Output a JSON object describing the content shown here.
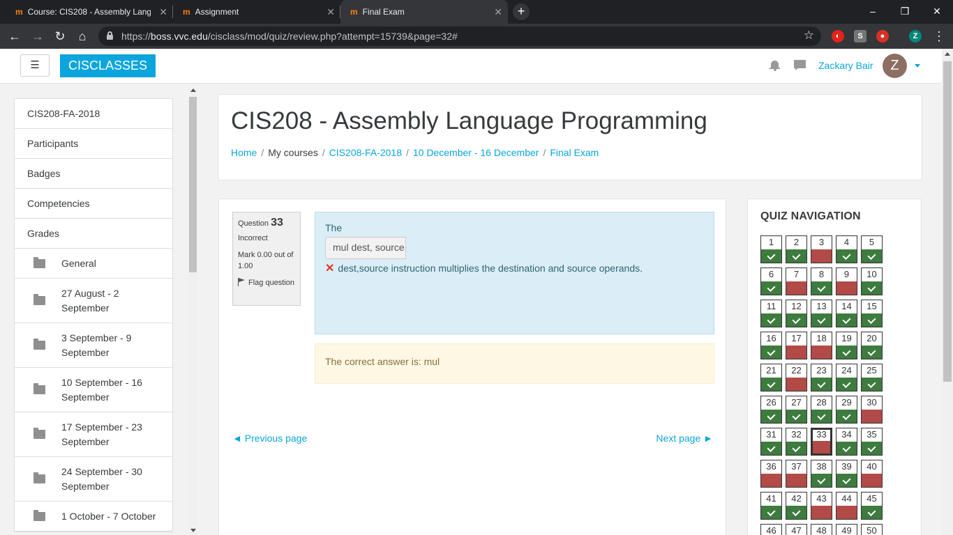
{
  "browser": {
    "tabs": [
      {
        "title": "Course: CIS208 - Assembly Language Programming",
        "active": false
      },
      {
        "title": "Assignment",
        "active": false
      },
      {
        "title": "Final Exam",
        "active": true
      }
    ],
    "url_prefix": "https://",
    "url_host": "boss.vvc.edu",
    "url_path": "/cisclass/mod/quiz/review.php?attempt=15739&page=32#",
    "profile_initial": "Z",
    "favicon_text": "m"
  },
  "header": {
    "menu_icon": "hamburger-icon",
    "brand": "CISCLASSES",
    "username": "Zackary Bair",
    "avatar_initial": "Z"
  },
  "drawer": {
    "items": [
      {
        "label": "CIS208-FA-2018",
        "folder": false
      },
      {
        "label": "Participants",
        "folder": false
      },
      {
        "label": "Badges",
        "folder": false
      },
      {
        "label": "Competencies",
        "folder": false
      },
      {
        "label": "Grades",
        "folder": false
      },
      {
        "label": "General",
        "folder": true
      },
      {
        "label": "27 August - 2 September",
        "folder": true
      },
      {
        "label": "3 September - 9 September",
        "folder": true
      },
      {
        "label": "10 September - 16 September",
        "folder": true
      },
      {
        "label": "17 September - 23 September",
        "folder": true
      },
      {
        "label": "24 September - 30 September",
        "folder": true
      },
      {
        "label": "1 October - 7 October",
        "folder": true
      }
    ]
  },
  "page": {
    "course_title": "CIS208 - Assembly Language Programming",
    "breadcrumb": {
      "home": "Home",
      "my_courses": "My courses",
      "course": "CIS208-FA-2018",
      "section": "10 December - 16 December",
      "activity": "Final Exam"
    }
  },
  "question": {
    "label": "Question",
    "number": "33",
    "state": "Incorrect",
    "mark": "Mark 0.00 out of 1.00",
    "flag": "Flag question",
    "prompt": "The",
    "answer_value": "mul dest, source",
    "feedback_text": "dest,source instruction multiplies the destination and source operands.",
    "correct_answer": "The correct answer is: mul"
  },
  "pager": {
    "previous": "◄ Previous page",
    "next": "Next page ►"
  },
  "quiz_nav": {
    "title": "QUIZ NAVIGATION",
    "current": 33,
    "questions": [
      {
        "n": "1",
        "s": "correct"
      },
      {
        "n": "2",
        "s": "correct"
      },
      {
        "n": "3",
        "s": "incorrect"
      },
      {
        "n": "4",
        "s": "correct"
      },
      {
        "n": "5",
        "s": "correct"
      },
      {
        "n": "6",
        "s": "correct"
      },
      {
        "n": "7",
        "s": "incorrect"
      },
      {
        "n": "8",
        "s": "correct"
      },
      {
        "n": "9",
        "s": "incorrect"
      },
      {
        "n": "10",
        "s": "correct"
      },
      {
        "n": "11",
        "s": "correct"
      },
      {
        "n": "12",
        "s": "correct"
      },
      {
        "n": "13",
        "s": "correct"
      },
      {
        "n": "14",
        "s": "correct"
      },
      {
        "n": "15",
        "s": "correct"
      },
      {
        "n": "16",
        "s": "correct"
      },
      {
        "n": "17",
        "s": "incorrect"
      },
      {
        "n": "18",
        "s": "incorrect"
      },
      {
        "n": "19",
        "s": "correct"
      },
      {
        "n": "20",
        "s": "correct"
      },
      {
        "n": "21",
        "s": "correct"
      },
      {
        "n": "22",
        "s": "incorrect"
      },
      {
        "n": "23",
        "s": "correct"
      },
      {
        "n": "24",
        "s": "correct"
      },
      {
        "n": "25",
        "s": "correct"
      },
      {
        "n": "26",
        "s": "correct"
      },
      {
        "n": "27",
        "s": "correct"
      },
      {
        "n": "28",
        "s": "correct"
      },
      {
        "n": "29",
        "s": "correct"
      },
      {
        "n": "30",
        "s": "incorrect"
      },
      {
        "n": "31",
        "s": "correct"
      },
      {
        "n": "32",
        "s": "correct"
      },
      {
        "n": "33",
        "s": "incorrect"
      },
      {
        "n": "34",
        "s": "correct"
      },
      {
        "n": "35",
        "s": "correct"
      },
      {
        "n": "36",
        "s": "incorrect"
      },
      {
        "n": "37",
        "s": "incorrect"
      },
      {
        "n": "38",
        "s": "correct"
      },
      {
        "n": "39",
        "s": "correct"
      },
      {
        "n": "40",
        "s": "incorrect"
      },
      {
        "n": "41",
        "s": "correct"
      },
      {
        "n": "42",
        "s": "correct"
      },
      {
        "n": "43",
        "s": "incorrect"
      },
      {
        "n": "44",
        "s": "incorrect"
      },
      {
        "n": "45",
        "s": "correct"
      },
      {
        "n": "46",
        "s": "correct"
      },
      {
        "n": "47",
        "s": "correct"
      },
      {
        "n": "48",
        "s": "correct"
      },
      {
        "n": "49",
        "s": "correct"
      },
      {
        "n": "50",
        "s": "correct"
      }
    ]
  },
  "colors": {
    "brand": "#0aa5dc",
    "correct": "#3d7b3f",
    "incorrect": "#b24a48",
    "info_bg": "#dbedf6",
    "warning_bg": "#fcf8e3"
  }
}
